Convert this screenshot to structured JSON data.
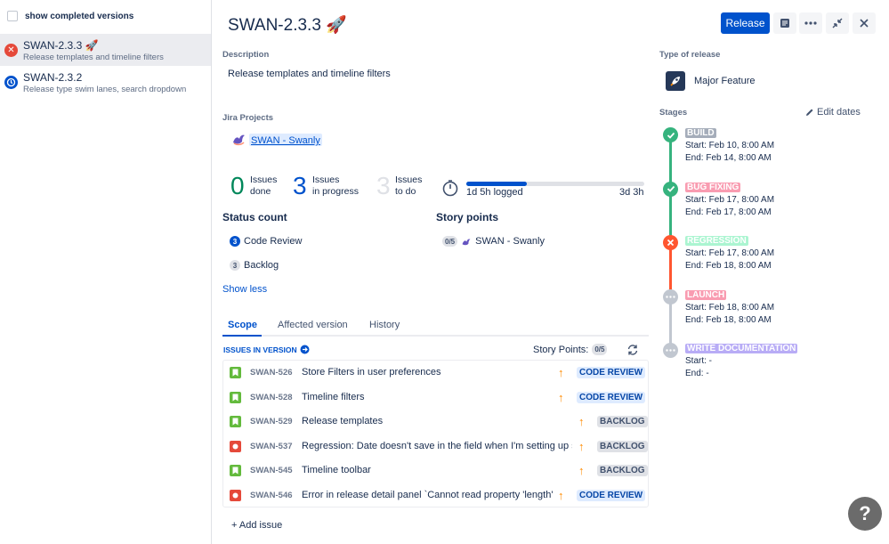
{
  "sidebar": {
    "show_completed_label": "show completed versions",
    "versions": [
      {
        "name": "SWAN-2.3.3 🚀",
        "description": "Release templates and timeline filters",
        "status": "error",
        "selected": true
      },
      {
        "name": "SWAN-2.3.2",
        "description": "Release type swim lanes, search dropdown",
        "status": "in-progress",
        "selected": false
      }
    ]
  },
  "header": {
    "title": "SWAN-2.3.3 🚀",
    "release_label": "Release",
    "icons": [
      "notes-icon",
      "more-icon",
      "collapse-icon",
      "close-icon"
    ]
  },
  "description": {
    "label": "Description",
    "text": "Release templates and timeline filters"
  },
  "projects": {
    "label": "Jira Projects",
    "project_name": "SWAN - Swanly"
  },
  "stats": {
    "done": {
      "count": "0",
      "label1": "Issues",
      "label2": "done"
    },
    "in_progress": {
      "count": "3",
      "label1": "Issues",
      "label2": "in progress"
    },
    "todo": {
      "count": "3",
      "label1": "Issues",
      "label2": "to do"
    },
    "logged": "1d 5h logged",
    "remaining": "3d 3h",
    "logged_fraction": 0.34
  },
  "status_count": {
    "title": "Status count",
    "items": [
      {
        "count": "3",
        "label": "Code Review"
      },
      {
        "count": "3",
        "label": "Backlog"
      }
    ],
    "show_less": "Show less"
  },
  "story_points": {
    "title": "Story points",
    "value": "0/5",
    "project": "SWAN - Swanly"
  },
  "tabs": [
    "Scope",
    "Affected version",
    "History"
  ],
  "issues_section": {
    "label": "ISSUES IN VERSION",
    "story_points_label": "Story Points:",
    "story_points_value": "0/5",
    "add_issue": "+ Add issue"
  },
  "issues": [
    {
      "key": "SWAN-526",
      "summary": "Store Filters in user preferences",
      "type": "story",
      "status": "CODE REVIEW"
    },
    {
      "key": "SWAN-528",
      "summary": "Timeline filters",
      "type": "story",
      "status": "CODE REVIEW"
    },
    {
      "key": "SWAN-529",
      "summary": "Release templates",
      "type": "story",
      "status": "BACKLOG"
    },
    {
      "key": "SWAN-537",
      "summary": "Regression: Date doesn't save in the field when I'm setting up s",
      "type": "bug",
      "status": "BACKLOG"
    },
    {
      "key": "SWAN-545",
      "summary": "Timeline toolbar",
      "type": "story",
      "status": "BACKLOG"
    },
    {
      "key": "SWAN-546",
      "summary": "Error in release detail panel `Cannot read property 'length'",
      "type": "bug",
      "status": "CODE REVIEW"
    }
  ],
  "release_type": {
    "label": "Type of release",
    "value": "Major Feature"
  },
  "stages": {
    "label": "Stages",
    "edit_label": "Edit dates",
    "items": [
      {
        "name": "BUILD",
        "color": "#A5ADBA",
        "state": "done",
        "start": "Start: Feb 10, 8:00 AM",
        "end": "End: Feb 14, 8:00 AM"
      },
      {
        "name": "BUG FIXING",
        "color": "#F99CB1",
        "state": "done",
        "start": "Start: Feb 17, 8:00 AM",
        "end": "End: Feb 17, 8:00 AM"
      },
      {
        "name": "REGRESSION",
        "color": "#ABF5D1",
        "state": "error",
        "start": "Start: Feb 17, 8:00 AM",
        "end": "End: Feb 18, 8:00 AM"
      },
      {
        "name": "LAUNCH",
        "color": "#F99CB1",
        "state": "pending",
        "start": "Start: Feb 18, 8:00 AM",
        "end": "End: Feb 18, 8:00 AM"
      },
      {
        "name": "WRITE DOCUMENTATION",
        "color": "#B8ACF6",
        "state": "pending",
        "start": "Start: -",
        "end": "End: -"
      }
    ]
  },
  "help_label": "?"
}
